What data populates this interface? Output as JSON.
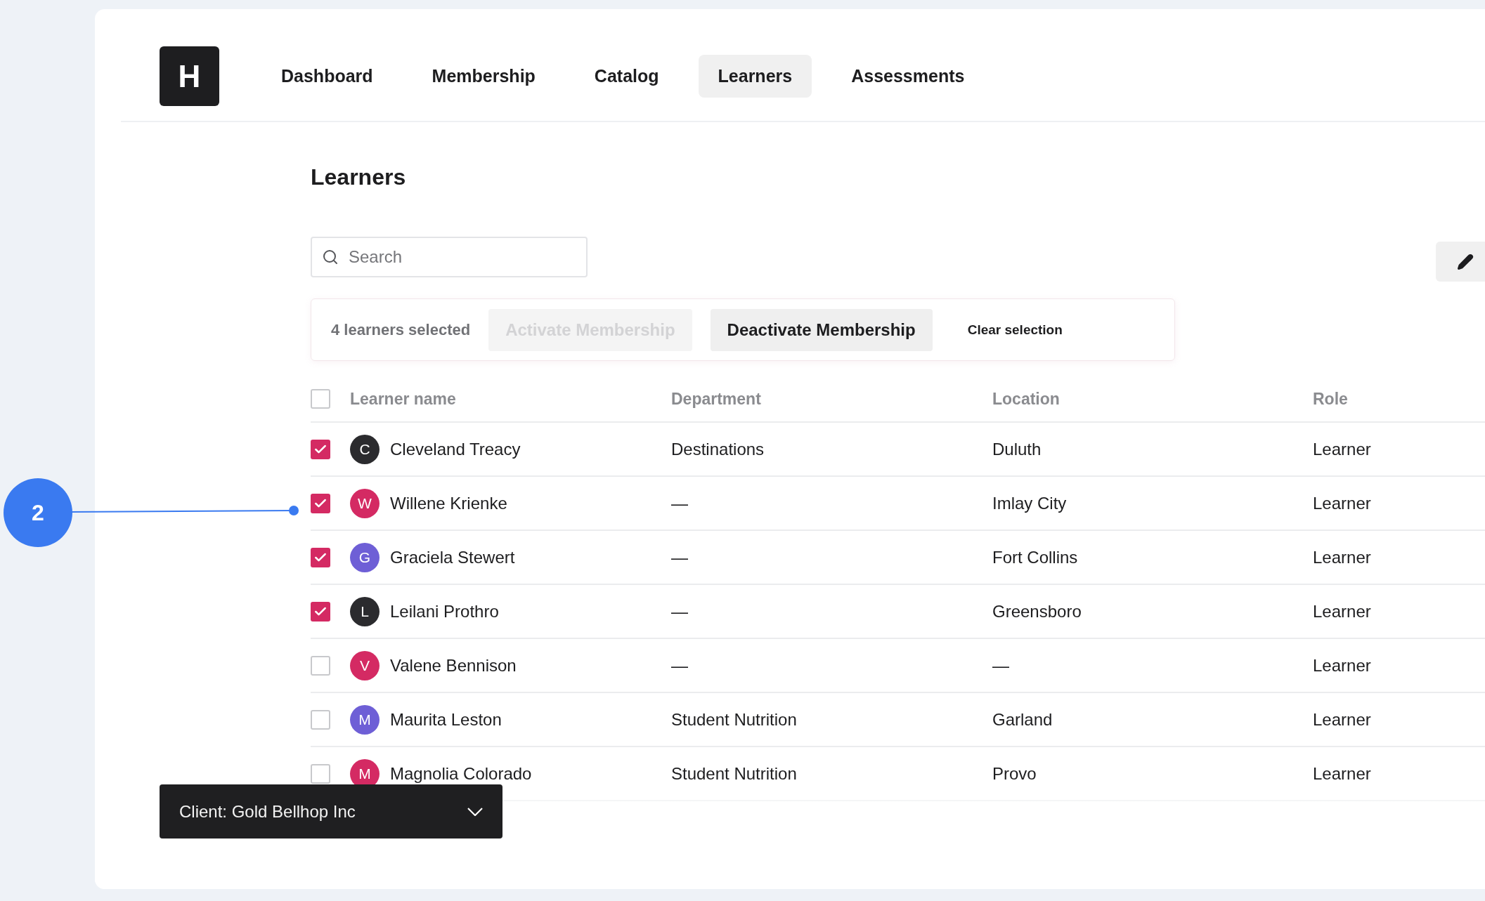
{
  "nav": {
    "logo": "H",
    "items": [
      {
        "label": "Dashboard",
        "selected": false
      },
      {
        "label": "Membership",
        "selected": false
      },
      {
        "label": "Catalog",
        "selected": false
      },
      {
        "label": "Learners",
        "selected": true
      },
      {
        "label": "Assessments",
        "selected": false
      }
    ]
  },
  "page_title": "Learners",
  "search": {
    "placeholder": "Search"
  },
  "selection_bar": {
    "count": "4 learners selected",
    "buttons": [
      {
        "label": "Activate Membership",
        "disabled": true,
        "kind": "filled"
      },
      {
        "label": "Deactivate Membership",
        "disabled": false,
        "kind": "filled"
      },
      {
        "label": "Clear selection",
        "disabled": false,
        "kind": "plain"
      }
    ]
  },
  "table": {
    "select_all_checked": false,
    "columns": [
      "Learner name",
      "Department",
      "Location",
      "Role"
    ],
    "rows": [
      {
        "initial": "C",
        "color": "#2b2b2e",
        "name": "Cleveland Treacy",
        "department": "Destinations",
        "location": "Duluth",
        "role": "Learner",
        "checked": true
      },
      {
        "initial": "W",
        "color": "#d42a63",
        "name": "Willene Krienke",
        "department": "—",
        "location": "Imlay City",
        "role": "Learner",
        "checked": true
      },
      {
        "initial": "G",
        "color": "#6e5fd6",
        "name": "Graciela Stewert",
        "department": "—",
        "location": "Fort Collins",
        "role": "Learner",
        "checked": true
      },
      {
        "initial": "L",
        "color": "#2b2b2e",
        "name": "Leilani Prothro",
        "department": "—",
        "location": "Greensboro",
        "role": "Learner",
        "checked": true
      },
      {
        "initial": "V",
        "color": "#d42a63",
        "name": "Valene Bennison",
        "department": "—",
        "location": "—",
        "role": "Learner",
        "checked": false
      },
      {
        "initial": "M",
        "color": "#6e5fd6",
        "name": "Maurita Leston",
        "department": "Student Nutrition",
        "location": "Garland",
        "role": "Learner",
        "checked": false
      },
      {
        "initial": "M",
        "color": "#d42a63",
        "name": "Magnolia Colorado",
        "department": "Student Nutrition",
        "location": "Provo",
        "role": "Learner",
        "checked": false
      }
    ]
  },
  "client_dropdown": {
    "label": "Client: Gold Bellhop Inc"
  },
  "callout": {
    "number": "2"
  }
}
